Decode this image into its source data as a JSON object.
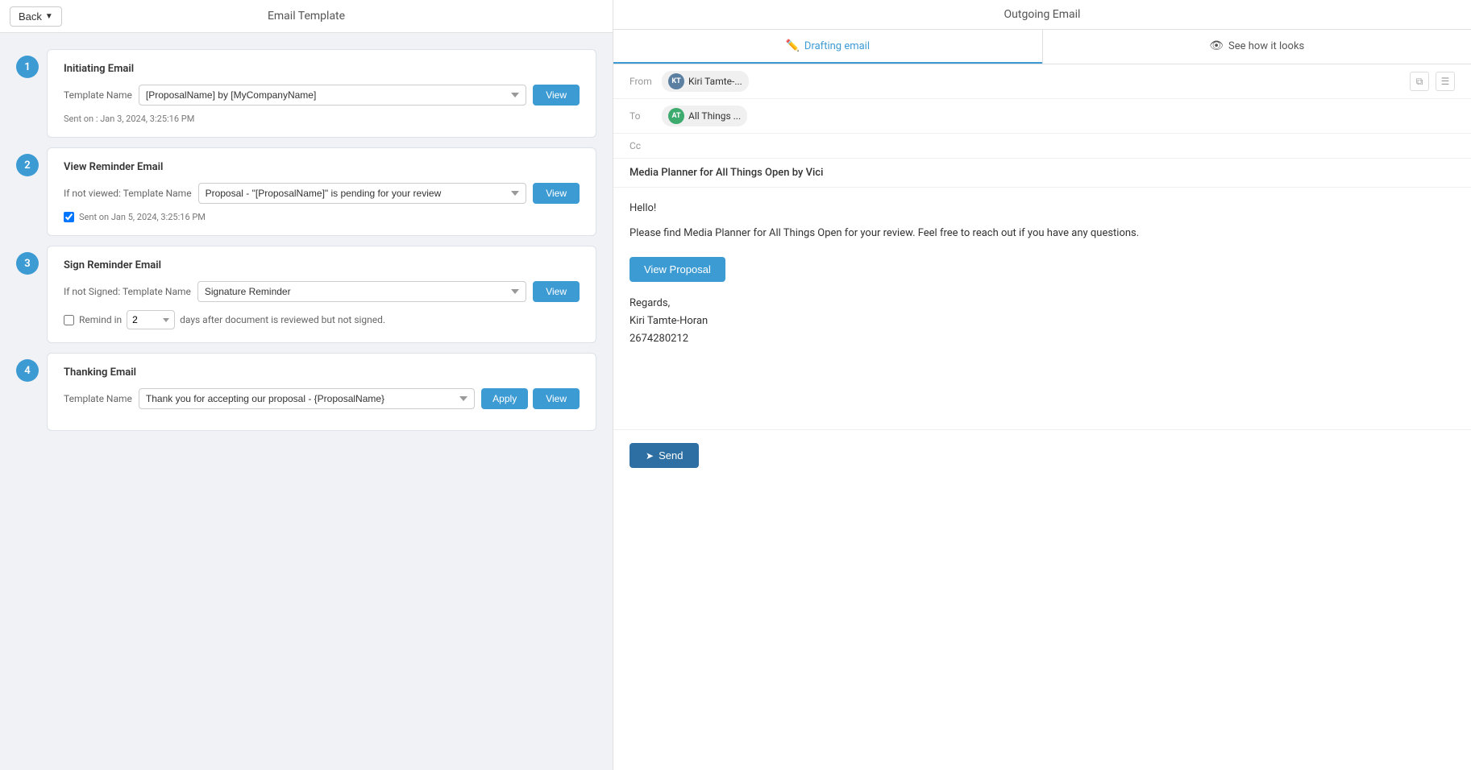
{
  "left_header": {
    "back_label": "Back",
    "title": "Email Template"
  },
  "right_header": {
    "title": "Outgoing Email"
  },
  "tabs": [
    {
      "id": "drafting",
      "label": "Drafting email",
      "icon": "✏️",
      "active": true
    },
    {
      "id": "preview",
      "label": "See how it looks",
      "icon": "👁",
      "active": false
    }
  ],
  "steps": [
    {
      "number": "1",
      "title": "Initiating Email",
      "template_label": "Template Name",
      "template_value": "[ProposalName] by [MyCompanyName]",
      "sent_info": "Sent on : Jan 3, 2024, 3:25:16 PM",
      "view_btn": "View"
    },
    {
      "number": "2",
      "title": "View Reminder Email",
      "template_label": "If not viewed: Template Name",
      "template_value": "Proposal - \"[ProposalName]\" is pending for your review",
      "checkbox_checked": true,
      "checkbox_label": "Sent on Jan 5, 2024, 3:25:16 PM",
      "view_btn": "View"
    },
    {
      "number": "3",
      "title": "Sign Reminder Email",
      "template_label": "If not Signed: Template Name",
      "template_value": "Signature Reminder",
      "checkbox_checked": false,
      "remind_label": "Remind in",
      "remind_value": "2",
      "remind_suffix": "days after document is reviewed but not signed.",
      "view_btn": "View"
    },
    {
      "number": "4",
      "title": "Thanking Email",
      "template_label": "Template Name",
      "template_value": "Thank you for accepting our proposal - {ProposalName}",
      "apply_btn": "Apply",
      "view_btn": "View"
    }
  ],
  "email": {
    "from_label": "From",
    "from_name": "Kiri Tamte-...",
    "from_initials": "KT",
    "to_label": "To",
    "to_name": "All Things ...",
    "to_initials": "AT",
    "cc_label": "Cc",
    "subject": "Media Planner for All Things Open by Vici",
    "body_greeting": "Hello!",
    "body_paragraph": "Please find Media Planner for All Things Open for your review. Feel free to reach out if you have any questions.",
    "view_proposal_btn": "View Proposal",
    "signature_regards": "Regards,",
    "signature_name": "Kiri Tamte-Horan",
    "signature_phone": "2674280212",
    "send_btn": "Send"
  }
}
